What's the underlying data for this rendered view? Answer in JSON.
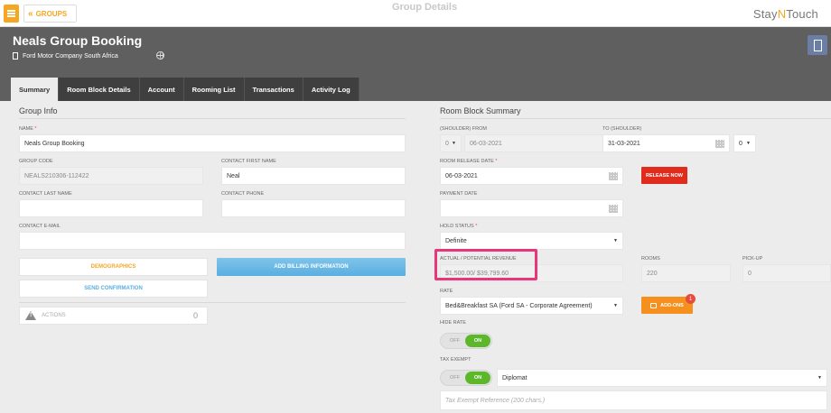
{
  "topbar": {
    "groups_label": "GROUPS",
    "center_title": "Group Details",
    "logo_part1": "Stay",
    "logo_n": "N",
    "logo_part2": "Touch"
  },
  "header": {
    "group_name": "Neals Group Booking",
    "company": "Ford Motor Company South Africa"
  },
  "tabs": [
    {
      "label": "Summary"
    },
    {
      "label": "Room Block Details"
    },
    {
      "label": "Account"
    },
    {
      "label": "Rooming List"
    },
    {
      "label": "Transactions"
    },
    {
      "label": "Activity Log"
    }
  ],
  "group_info": {
    "title": "Group Info",
    "name_label": "NAME",
    "name_value": "Neals Group Booking",
    "group_code_label": "GROUP CODE",
    "group_code_value": "NEALS210306-112422",
    "contact_first_name_label": "CONTACT FIRST NAME",
    "contact_first_name_value": "Neal",
    "contact_last_name_label": "CONTACT LAST NAME",
    "contact_last_name_value": "",
    "contact_phone_label": "CONTACT PHONE",
    "contact_phone_value": "",
    "contact_email_label": "CONTACT E-MAIL",
    "contact_email_value": "",
    "demographics_label": "DEMOGRAPHICS",
    "add_billing_label": "ADD BILLING INFORMATION",
    "send_confirmation_label": "SEND CONFIRMATION",
    "actions_label": "ACTIONS",
    "actions_count": "0"
  },
  "room_block": {
    "title": "Room Block Summary",
    "from_label": "(SHOULDER) FROM",
    "from_shoulder": "0",
    "from_date": "06-03-2021",
    "to_label": "TO (SHOULDER)",
    "to_date": "31-03-2021",
    "to_shoulder": "0",
    "release_date_label": "ROOM RELEASE DATE",
    "release_date_value": "06-03-2021",
    "release_now_label": "RELEASE NOW",
    "payment_date_label": "PAYMENT DATE",
    "payment_date_value": "",
    "hold_status_label": "HOLD STATUS",
    "hold_status_value": "Definite",
    "revenue_label": "ACTUAL / POTENTIAL REVENUE",
    "revenue_value": "$1,500.00/ $39,799.60",
    "rooms_label": "ROOMS",
    "rooms_value": "220",
    "pickup_label": "PICK-UP",
    "pickup_value": "0",
    "rate_label": "RATE",
    "rate_value": "Bed&Breakfast SA (Ford SA - Corporate Agreement)",
    "addons_label": "ADD-ONS",
    "addons_badge": "1",
    "hide_rate_label": "HIDE RATE",
    "toggle_off": "OFF",
    "toggle_on": "ON",
    "tax_exempt_label": "TAX EXEMPT",
    "tax_exempt_type": "Diplomat",
    "tax_reference_placeholder": "Tax Exempt Reference (200 chars.)"
  },
  "colors": {
    "accent": "#f5a623",
    "header_bg": "#5f5f5f",
    "release_btn": "#e02c1c",
    "addons_btn": "#f5901e",
    "toggle_on": "#5cb82a",
    "highlight": "#e8367a"
  }
}
